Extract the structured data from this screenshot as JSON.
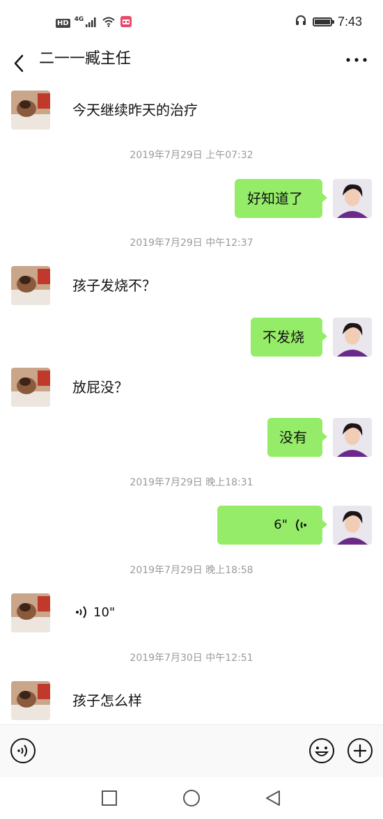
{
  "status": {
    "hd": "HD",
    "network": "4G",
    "time": "7:43"
  },
  "header": {
    "title": "二一一臧主任"
  },
  "messages": {
    "m1": {
      "text": "今天继续昨天的治疗"
    },
    "ts1": "2019年7月29日 上午07:32",
    "m2": {
      "text": "好知道了"
    },
    "ts2": "2019年7月29日 中午12:37",
    "m3": {
      "text": "孩子发烧不？"
    },
    "m4": {
      "text": "不发烧"
    },
    "m5": {
      "text": "放屁没？"
    },
    "m6": {
      "text": "没有"
    },
    "ts3": "2019年7月29日 晚上18:31",
    "m7": {
      "duration": "6\""
    },
    "ts4": "2019年7月29日 晚上18:58",
    "m8": {
      "duration": "10\""
    },
    "ts5": "2019年7月30日 中午12:51",
    "m9": {
      "text": "孩子怎么样"
    }
  },
  "colors": {
    "bubble_out": "#95ec69",
    "timestamp": "#9a9a9a"
  },
  "icons": {
    "back": "chevron-left-icon",
    "more": "more-horizontal-icon",
    "voice_mode": "voice-mode-icon",
    "emoji": "emoji-icon",
    "plus": "plus-icon",
    "nav_recent": "square-icon",
    "nav_home": "circle-icon",
    "nav_back": "triangle-back-icon"
  }
}
